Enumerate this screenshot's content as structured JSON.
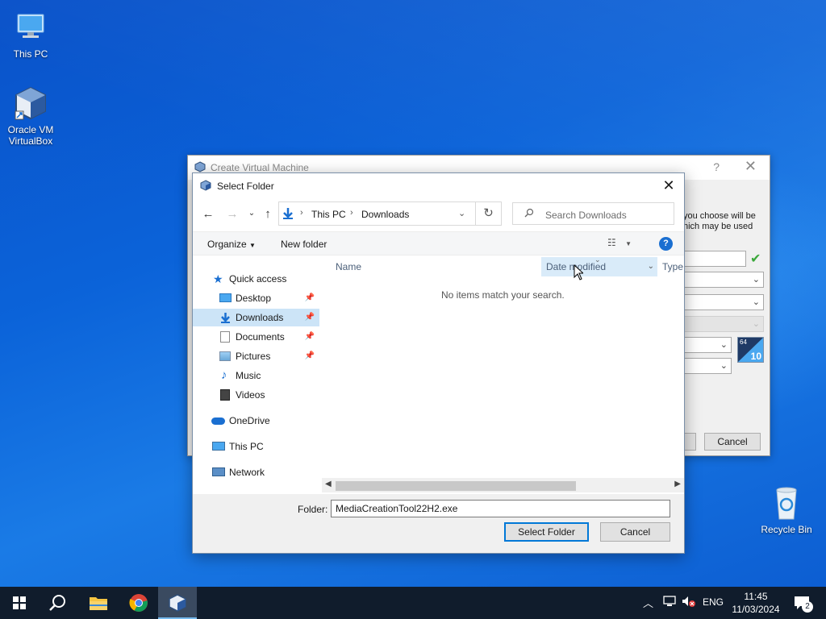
{
  "desktop": {
    "icons": [
      {
        "label": "This PC"
      },
      {
        "label": "Oracle VM VirtualBox"
      },
      {
        "label": "Recycle Bin"
      }
    ]
  },
  "bg_dialog": {
    "title": "Create Virtual Machine",
    "help": "?",
    "close": "✕",
    "text": "you choose will be\nhich may be used",
    "cancel_label": "Cancel",
    "os_badge": "10",
    "os_badge_bits": "64"
  },
  "dialog": {
    "title": "Select Folder",
    "close": "✕",
    "breadcrumb": [
      "This PC",
      "Downloads"
    ],
    "search_placeholder": "Search Downloads",
    "toolbar": {
      "organize": "Organize",
      "new_folder": "New folder"
    },
    "nav": [
      {
        "label": "Quick access"
      },
      {
        "label": "Desktop"
      },
      {
        "label": "Downloads"
      },
      {
        "label": "Documents"
      },
      {
        "label": "Pictures"
      },
      {
        "label": "Music"
      },
      {
        "label": "Videos"
      },
      {
        "label": "OneDrive"
      },
      {
        "label": "This PC"
      },
      {
        "label": "Network"
      }
    ],
    "columns": {
      "name": "Name",
      "date": "Date modified",
      "type": "Type"
    },
    "empty_message": "No items match your search.",
    "folder_label": "Folder:",
    "folder_value": "MediaCreationTool22H2.exe",
    "select_label": "Select Folder",
    "cancel_label": "Cancel"
  },
  "taskbar": {
    "language": "ENG",
    "time": "11:45",
    "date": "11/03/2024",
    "notifications": "2"
  },
  "colors": {
    "accent": "#0078d7",
    "selected_nav": "#cce4f7",
    "taskbar": "#101c2c"
  }
}
